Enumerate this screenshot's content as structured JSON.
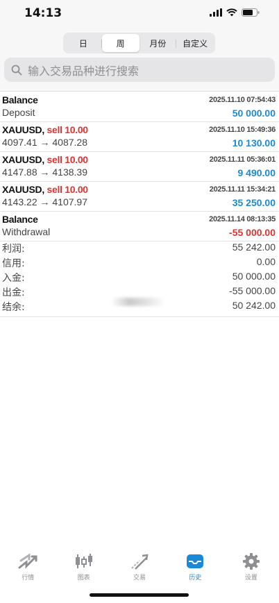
{
  "status": {
    "time": "14:13"
  },
  "tabs": [
    {
      "label": "日",
      "active": false
    },
    {
      "label": "周",
      "active": true
    },
    {
      "label": "月份",
      "active": false
    },
    {
      "label": "自定义",
      "active": false
    }
  ],
  "search": {
    "placeholder": "输入交易品种进行搜索"
  },
  "rows": [
    {
      "title": "Balance",
      "side": "",
      "detail": "Deposit",
      "date": "2025.11.10 07:54:43",
      "amount": "50 000.00",
      "negative": false
    },
    {
      "title": "XAUUSD,",
      "side": "sell 10.00",
      "detail": "4097.41 → 4087.28",
      "date": "2025.11.10 15:49:36",
      "amount": "10 130.00",
      "negative": false
    },
    {
      "title": "XAUUSD,",
      "side": "sell 10.00",
      "detail": "4147.88 → 4138.39",
      "date": "2025.11.11 05:36:01",
      "amount": "9 490.00",
      "negative": false
    },
    {
      "title": "XAUUSD,",
      "side": "sell 10.00",
      "detail": "4143.22 → 4107.97",
      "date": "2025.11.11 15:34:21",
      "amount": "35 250.00",
      "negative": false
    },
    {
      "title": "Balance",
      "side": "",
      "detail": "Withdrawal",
      "date": "2025.11.14 08:13:35",
      "amount": "-55 000.00",
      "negative": true
    }
  ],
  "summary": [
    {
      "label": "利润:",
      "value": "55 242.00"
    },
    {
      "label": "信用:",
      "value": "0.00"
    },
    {
      "label": "入金:",
      "value": "50 000.00"
    },
    {
      "label": "出金:",
      "value": "-55 000.00"
    },
    {
      "label": "结余:",
      "value": "50 242.00"
    }
  ],
  "nav": [
    {
      "label": "行情",
      "icon": "quotes-icon",
      "active": false
    },
    {
      "label": "图表",
      "icon": "candlestick-chart-icon",
      "active": false
    },
    {
      "label": "交易",
      "icon": "trade-icon",
      "active": false
    },
    {
      "label": "历史",
      "icon": "history-inbox-icon",
      "active": true
    },
    {
      "label": "设置",
      "icon": "gear-icon",
      "active": false
    }
  ],
  "colors": {
    "accent": "#1a8ad8",
    "sell": "#e2312f",
    "inactive": "#8e8e93"
  }
}
